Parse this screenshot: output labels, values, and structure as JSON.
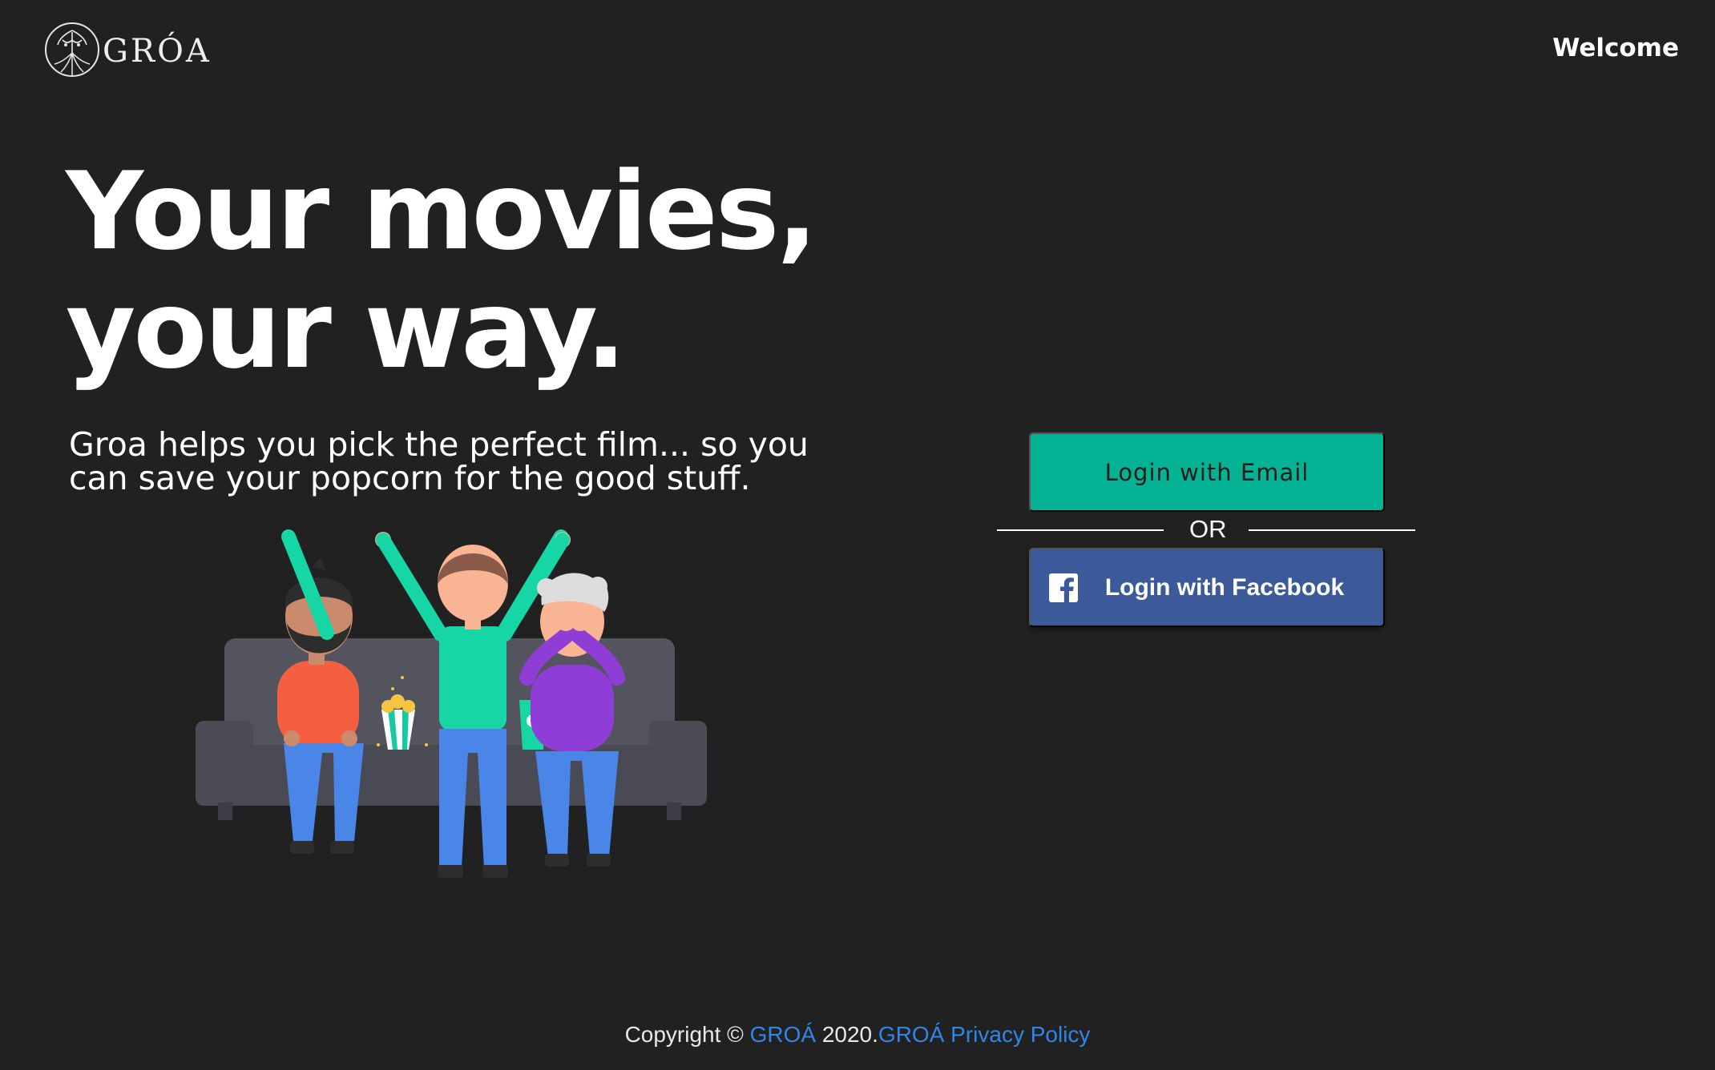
{
  "header": {
    "logo_text": "GRÓA",
    "nav_welcome": "Welcome"
  },
  "hero": {
    "title_line1": "Your movies,",
    "title_line2": "your way.",
    "subtitle_line1": "Groa helps you pick the perfect film... so you",
    "subtitle_line2": "can save your popcorn for the good stuff."
  },
  "login": {
    "email_label": "Login with Email",
    "or_label": "OR",
    "facebook_label": "Login with Facebook",
    "facebook_icon": "facebook-icon"
  },
  "footer": {
    "copyright": "Copyright © ",
    "brand_link": "GROÁ",
    "year": " 2020.",
    "privacy_link": "GROÁ Privacy Policy"
  },
  "colors": {
    "background": "#212121",
    "email_button": "#05b394",
    "facebook_button": "#3c5a99",
    "link": "#2f86e8"
  }
}
